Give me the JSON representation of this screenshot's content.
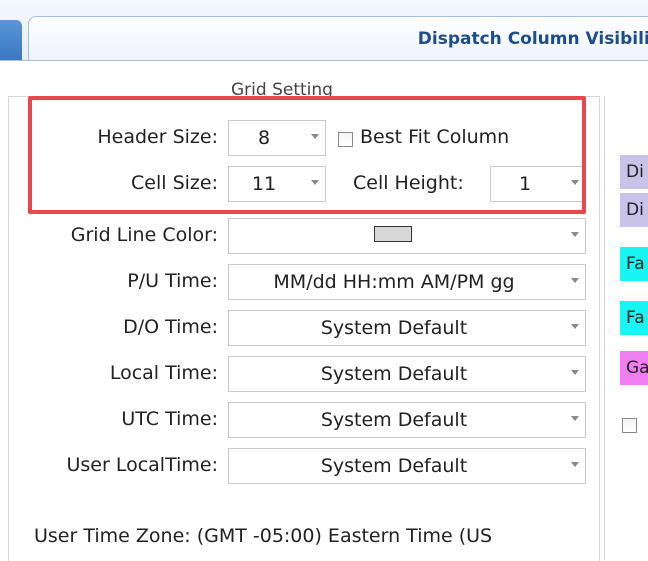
{
  "tab": {
    "title": "Dispatch Column Visibility"
  },
  "group": {
    "title": "Grid Setting"
  },
  "header_size": {
    "label": "Header Size:",
    "value": "8"
  },
  "best_fit": {
    "label": "Best Fit Column",
    "checked": false
  },
  "cell_size": {
    "label": "Cell Size:",
    "value": "11"
  },
  "cell_height": {
    "label": "Cell Height:",
    "value": "1"
  },
  "grid_line_color": {
    "label": "Grid Line Color:",
    "swatch_color": "#d8d8d8"
  },
  "pu_time": {
    "label": "P/U Time:",
    "value": "MM/dd HH:mm AM/PM gg"
  },
  "do_time": {
    "label": "D/O Time:",
    "value": "System Default"
  },
  "local_time": {
    "label": "Local Time:",
    "value": "System Default"
  },
  "utc_time": {
    "label": "UTC Time:",
    "value": "System Default"
  },
  "user_local_time": {
    "label": "User LocalTime:",
    "value": "System Default"
  },
  "user_time_zone": {
    "text": "User Time Zone: (GMT -05:00) Eastern Time (US"
  },
  "right_items": [
    {
      "text": "Di",
      "color": "#c9c3ea"
    },
    {
      "text": "Di",
      "color": "#c9c3ea"
    },
    {
      "text": "Fa",
      "color": "#19f5f2"
    },
    {
      "text": "Fa",
      "color": "#19f5f2"
    },
    {
      "text": "Ga",
      "color": "#f07ef0"
    }
  ],
  "colors": {
    "highlight": "#e8474c",
    "tab_title": "#1e4d8c"
  }
}
